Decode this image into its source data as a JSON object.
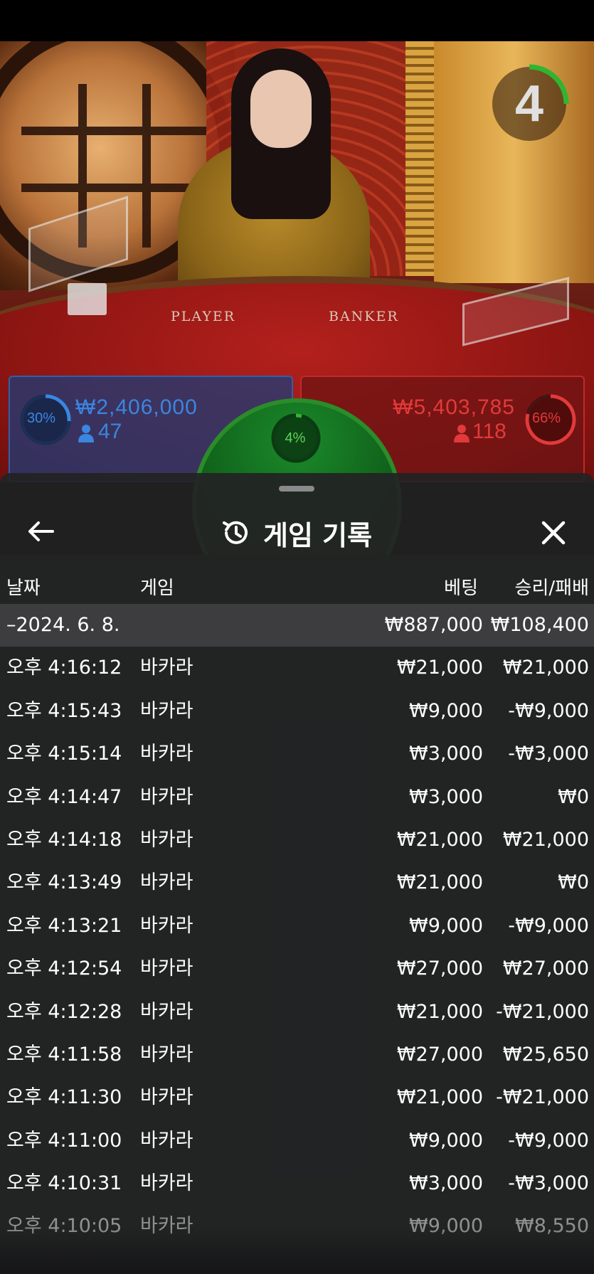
{
  "video": {
    "timer": "4",
    "table_labels": {
      "player": "PLAYER",
      "banker": "BANKER"
    }
  },
  "bets": {
    "player": {
      "percent": "30%",
      "amount": "₩2,406,000",
      "players": "47"
    },
    "banker": {
      "percent": "66%",
      "amount": "₩5,403,785",
      "players": "118"
    },
    "tie": {
      "percent": "4%"
    }
  },
  "colors": {
    "player_blue": "#3a86e0",
    "banker_red": "#e23a3a",
    "tie_green": "#2fb52f",
    "sheet_bg": "#222224",
    "summary_row_bg": "#3d3d40"
  },
  "history": {
    "title": "게임 기록",
    "icons": {
      "back": "arrow-left-icon",
      "history": "history-icon",
      "close": "close-icon"
    },
    "columns": {
      "date": "날짜",
      "game": "게임",
      "bet": "베팅",
      "result": "승리/패배"
    },
    "summary": {
      "date": "–2024. 6. 8.",
      "bet": "₩887,000",
      "result": "₩108,400"
    },
    "rows": [
      {
        "time": "오후 4:16:12",
        "game": "바카라",
        "bet": "₩21,000",
        "result": "₩21,000"
      },
      {
        "time": "오후 4:15:43",
        "game": "바카라",
        "bet": "₩9,000",
        "result": "-₩9,000"
      },
      {
        "time": "오후 4:15:14",
        "game": "바카라",
        "bet": "₩3,000",
        "result": "-₩3,000"
      },
      {
        "time": "오후 4:14:47",
        "game": "바카라",
        "bet": "₩3,000",
        "result": "₩0"
      },
      {
        "time": "오후 4:14:18",
        "game": "바카라",
        "bet": "₩21,000",
        "result": "₩21,000"
      },
      {
        "time": "오후 4:13:49",
        "game": "바카라",
        "bet": "₩21,000",
        "result": "₩0"
      },
      {
        "time": "오후 4:13:21",
        "game": "바카라",
        "bet": "₩9,000",
        "result": "-₩9,000"
      },
      {
        "time": "오후 4:12:54",
        "game": "바카라",
        "bet": "₩27,000",
        "result": "₩27,000"
      },
      {
        "time": "오후 4:12:28",
        "game": "바카라",
        "bet": "₩21,000",
        "result": "-₩21,000"
      },
      {
        "time": "오후 4:11:58",
        "game": "바카라",
        "bet": "₩27,000",
        "result": "₩25,650"
      },
      {
        "time": "오후 4:11:30",
        "game": "바카라",
        "bet": "₩21,000",
        "result": "-₩21,000"
      },
      {
        "time": "오후 4:11:00",
        "game": "바카라",
        "bet": "₩9,000",
        "result": "-₩9,000"
      },
      {
        "time": "오후 4:10:31",
        "game": "바카라",
        "bet": "₩3,000",
        "result": "-₩3,000"
      },
      {
        "time": "오후 4:10:05",
        "game": "바카라",
        "bet": "₩9,000",
        "result": "₩8,550"
      }
    ]
  }
}
